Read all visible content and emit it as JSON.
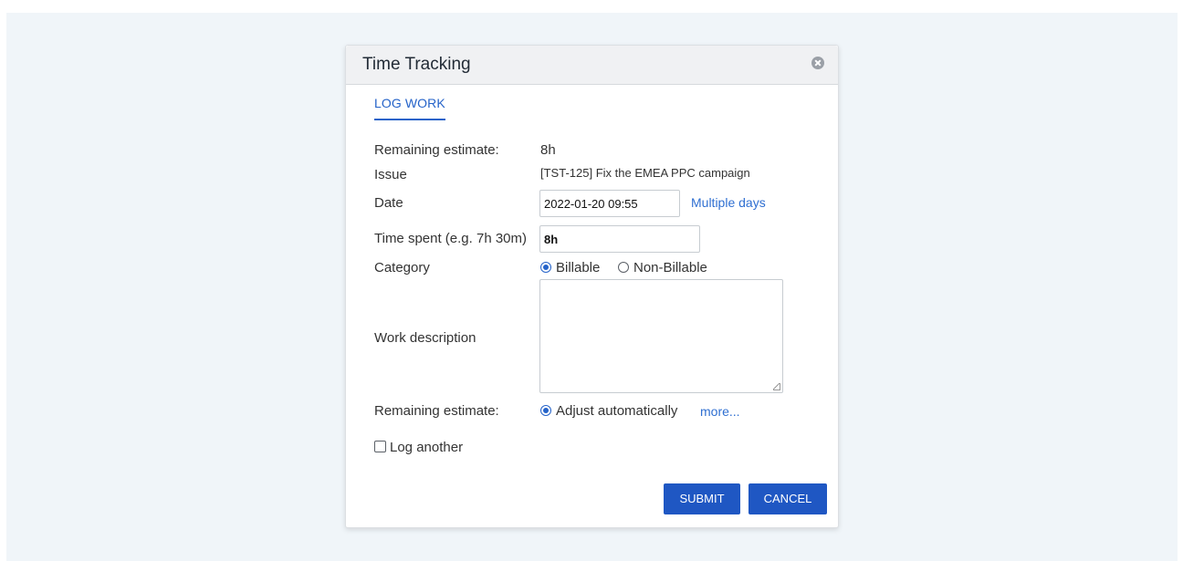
{
  "dialog": {
    "title": "Time Tracking",
    "tab": "LOG WORK"
  },
  "form": {
    "remaining_estimate_label": "Remaining estimate:",
    "remaining_estimate_value": "8h",
    "issue_label": "Issue",
    "issue_value": "[TST-125] Fix the EMEA PPC campaign",
    "date_label": "Date",
    "date_value": "2022-01-20 09:55",
    "multiple_days_link": "Multiple days",
    "time_spent_label": "Time spent (e.g. 7h 30m)",
    "time_spent_value": "8h",
    "category_label": "Category",
    "category_options": [
      "Billable",
      "Non-Billable"
    ],
    "category_selected": "Billable",
    "work_description_label": "Work description",
    "work_description_value": "",
    "remaining_estimate_adjust_label": "Remaining estimate:",
    "adjust_option": "Adjust automatically",
    "more_link": "more...",
    "log_another_label": "Log another",
    "log_another_checked": false
  },
  "buttons": {
    "submit": "SUBMIT",
    "cancel": "CANCEL"
  },
  "colors": {
    "accent": "#1f57c3",
    "link": "#2f6fd1",
    "backdrop": "#f0f5f9"
  }
}
